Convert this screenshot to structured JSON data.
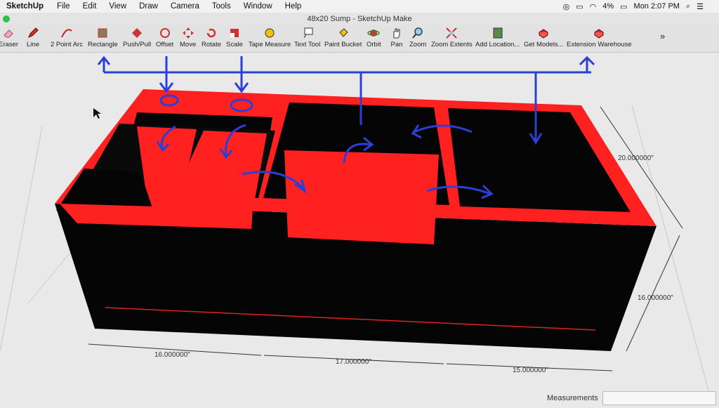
{
  "menubar": {
    "app": "SketchUp",
    "items": [
      "File",
      "Edit",
      "View",
      "Draw",
      "Camera",
      "Tools",
      "Window",
      "Help"
    ],
    "battery": "4%",
    "clock": "Mon 2:07 PM"
  },
  "window": {
    "title": "48x20 Sump - SketchUp Make"
  },
  "toolbar": {
    "tools": [
      {
        "label": "Eraser",
        "icon": "eraser-icon"
      },
      {
        "label": "Line",
        "icon": "pencil-icon"
      },
      {
        "label": "2 Point Arc",
        "icon": "arc-icon"
      },
      {
        "label": "Rectangle",
        "icon": "rectangle-icon"
      },
      {
        "label": "Push/Pull",
        "icon": "push-pull-icon"
      },
      {
        "label": "Offset",
        "icon": "offset-icon"
      },
      {
        "label": "Move",
        "icon": "move-icon"
      },
      {
        "label": "Rotate",
        "icon": "rotate-icon"
      },
      {
        "label": "Scale",
        "icon": "scale-icon"
      },
      {
        "label": "Tape Measure",
        "icon": "tape-measure-icon"
      },
      {
        "label": "Text Tool",
        "icon": "text-tool-icon"
      },
      {
        "label": "Paint Bucket",
        "icon": "paint-bucket-icon"
      },
      {
        "label": "Orbit",
        "icon": "orbit-icon"
      },
      {
        "label": "Pan",
        "icon": "pan-hand-icon"
      },
      {
        "label": "Zoom",
        "icon": "zoom-icon"
      },
      {
        "label": "Zoom Extents",
        "icon": "zoom-extents-icon"
      },
      {
        "label": "Add Location...",
        "icon": "add-location-icon"
      },
      {
        "label": "Get Models...",
        "icon": "get-models-icon"
      },
      {
        "label": "Extension Warehouse",
        "icon": "extension-warehouse-icon"
      }
    ],
    "overflow": "»"
  },
  "model": {
    "dimensions": [
      "20.000000\"",
      "16.000000\"",
      "16.000000\"",
      "17.000000\"",
      "15.000000\""
    ]
  },
  "measurements": {
    "label": "Measurements",
    "value": ""
  },
  "colors": {
    "box_red": "#ff2020",
    "box_black": "#050505",
    "annotation_blue": "#2b3fd6"
  }
}
